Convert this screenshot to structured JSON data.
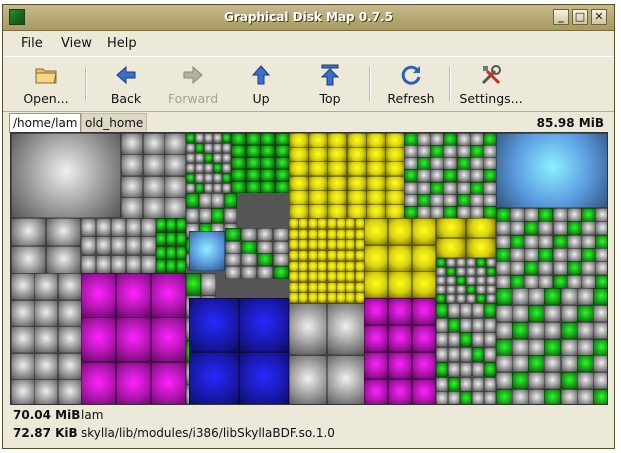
{
  "window": {
    "title": "Graphical Disk Map 0.7.5",
    "controls": {
      "minimize": "_",
      "maximize": "□",
      "close": "✕"
    }
  },
  "menu": {
    "items": [
      {
        "label": "File"
      },
      {
        "label": "View"
      },
      {
        "label": "Help"
      }
    ]
  },
  "toolbar": {
    "open": {
      "label": "Open...",
      "icon": "folder-icon"
    },
    "back": {
      "label": "Back",
      "icon": "arrow-left-icon"
    },
    "forward": {
      "label": "Forward",
      "icon": "arrow-right-icon",
      "disabled": true
    },
    "up": {
      "label": "Up",
      "icon": "arrow-up-icon"
    },
    "top": {
      "label": "Top",
      "icon": "arrow-top-icon"
    },
    "refresh": {
      "label": "Refresh",
      "icon": "refresh-icon"
    },
    "settings": {
      "label": "Settings...",
      "icon": "tools-icon"
    }
  },
  "path": {
    "crumbs": [
      {
        "label": "/home/lam",
        "active": true
      },
      {
        "label": "old_home",
        "active": false
      }
    ],
    "total_size": "85.98 MiB"
  },
  "status": {
    "line1": {
      "size": "70.04 MiB",
      "name": "lam"
    },
    "line2": {
      "size": "72.87 KiB",
      "name": "skylla/lib/modules/i386/libSkyllaBDF.so.1.0"
    }
  },
  "colors": {
    "gray": "#9a9a9a",
    "green": "#1aa31a",
    "yellow": "#d8d010",
    "magenta": "#b016b0",
    "blue": "#1a1ab0",
    "light_blue": "#5b9be0"
  }
}
